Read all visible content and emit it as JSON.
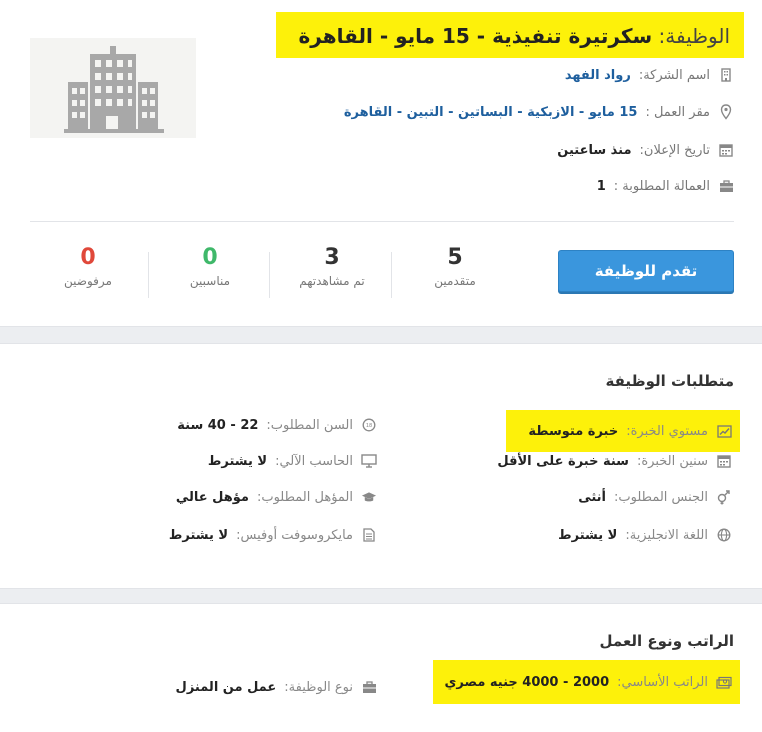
{
  "job": {
    "title_label": "الوظيفة:",
    "title_value": "سكرتيرة تنفيذية - 15 مايو - القاهرة",
    "company_label": "اسم الشركة:",
    "company_value": "رواد الفهد",
    "location_label": "مقر العمل :",
    "location_value": "15 مايو - الازبكية - البساتين - التبين - القاهرة",
    "posted_label": "تاريخ الإعلان:",
    "posted_value": "منذ ساعتين",
    "vacancies_label": "العمالة المطلوبة :",
    "vacancies_value": "1",
    "apply_label": "تقدم للوظيفة"
  },
  "stats": [
    {
      "value": "5",
      "label": "متقدمين",
      "color": "#333333"
    },
    {
      "value": "3",
      "label": "تم مشاهدتهم",
      "color": "#333333"
    },
    {
      "value": "0",
      "label": "مناسبين",
      "color": "#3fb86a"
    },
    {
      "value": "0",
      "label": "مرفوضين",
      "color": "#e0483a"
    }
  ],
  "requirements": {
    "title": "متطلبات الوظيفة",
    "experience_level_label": "مستوي الخبرة:",
    "experience_level_value": "خبرة متوسطة",
    "age_label": "السن المطلوب:",
    "age_value": "22 - 40 سنة",
    "experience_years_label": "سنين الخبرة:",
    "experience_years_value": "سنة خبرة على الأقل",
    "computer_label": "الحاسب الآلي:",
    "computer_value": "لا يشترط",
    "gender_label": "الجنس المطلوب:",
    "gender_value": "أنثى",
    "qualification_label": "المؤهل المطلوب:",
    "qualification_value": "مؤهل عالي",
    "english_label": "اللغة الانجليزية:",
    "english_value": "لا يشترط",
    "office_label": "مايكروسوفت أوفيس:",
    "office_value": "لا يشترط"
  },
  "salary": {
    "title": "الراتب ونوع العمل",
    "salary_label": "الراتب الأساسي:",
    "salary_value": "2000 - 4000 جنيه مصري",
    "job_type_label": "نوع الوظيفة:",
    "job_type_value": "عمل من المنزل"
  },
  "colors": {
    "highlight": "#fdf10a",
    "link": "#1e5f9e",
    "button": "#3a96dd"
  }
}
